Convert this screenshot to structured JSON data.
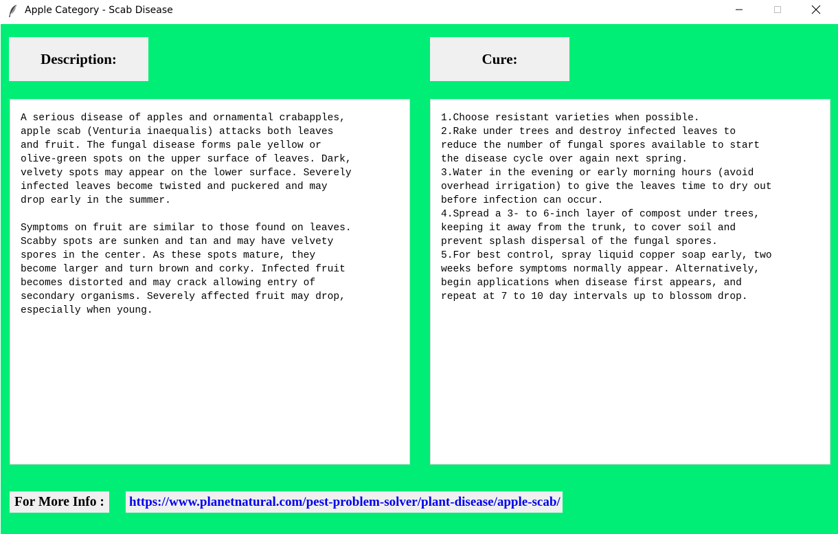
{
  "window": {
    "title": "Apple Category - Scab Disease",
    "app_icon": "feather-icon",
    "controls": [
      "minimize-icon",
      "maximize-icon",
      "close-icon"
    ]
  },
  "colors": {
    "background": "#00ee76",
    "header_bg": "#f0f0f0",
    "link": "#0000ee"
  },
  "description": {
    "heading": "Description:",
    "text": "A serious disease of apples and ornamental crabapples,\napple scab (Venturia inaequalis) attacks both leaves\nand fruit. The fungal disease forms pale yellow or\nolive-green spots on the upper surface of leaves. Dark,\nvelvety spots may appear on the lower surface. Severely\ninfected leaves become twisted and puckered and may\ndrop early in the summer.\n\nSymptoms on fruit are similar to those found on leaves.\nScabby spots are sunken and tan and may have velvety\nspores in the center. As these spots mature, they\nbecome larger and turn brown and corky. Infected fruit\nbecomes distorted and may crack allowing entry of\nsecondary organisms. Severely affected fruit may drop,\nespecially when young."
  },
  "cure": {
    "heading": "Cure:",
    "text": "1.Choose resistant varieties when possible.\n2.Rake under trees and destroy infected leaves to\nreduce the number of fungal spores available to start\nthe disease cycle over again next spring.\n3.Water in the evening or early morning hours (avoid\noverhead irrigation) to give the leaves time to dry out\nbefore infection can occur.\n4.Spread a 3- to 6-inch layer of compost under trees,\nkeeping it away from the trunk, to cover soil and\nprevent splash dispersal of the fungal spores.\n5.For best control, spray liquid copper soap early, two\nweeks before symptoms normally appear. Alternatively,\nbegin applications when disease first appears, and\nrepeat at 7 to 10 day intervals up to blossom drop."
  },
  "more_info": {
    "label": "For More Info :",
    "link": "https://www.planetnatural.com/pest-problem-solver/plant-disease/apple-scab/"
  }
}
